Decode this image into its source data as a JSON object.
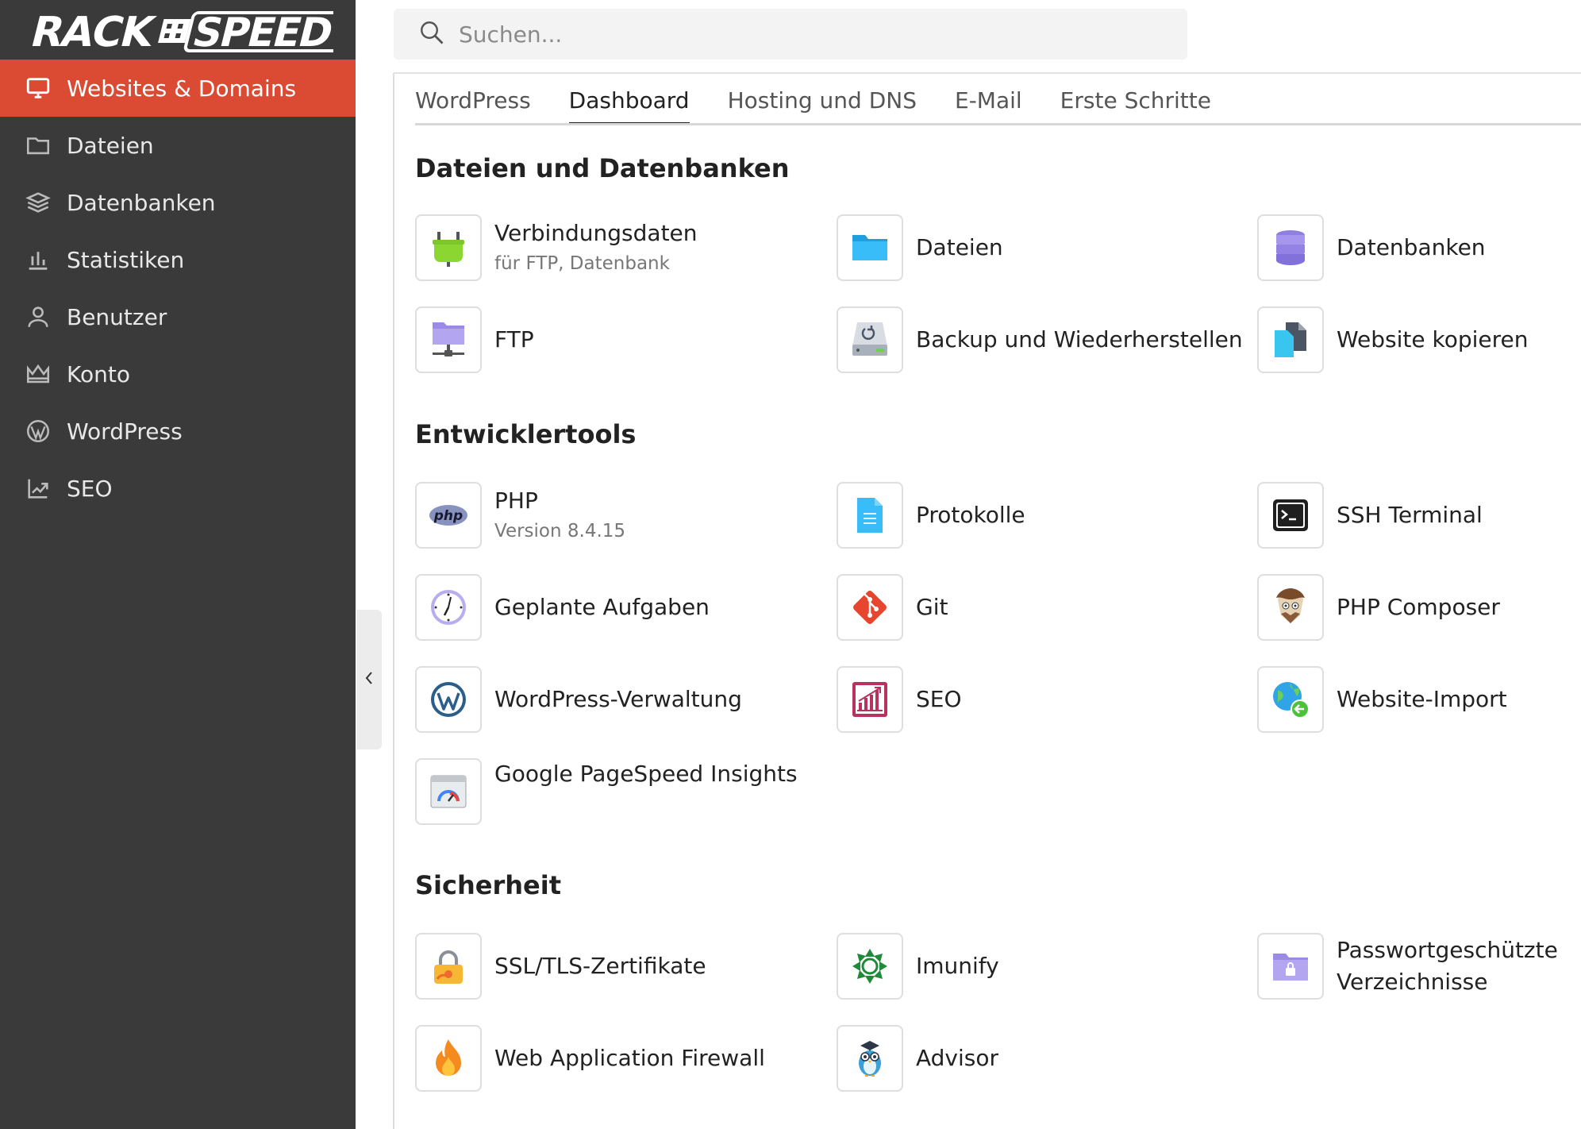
{
  "brand": {
    "logo_text": "RACK#SPEED"
  },
  "search": {
    "placeholder": "Suchen..."
  },
  "sidebar": {
    "items": [
      {
        "label": "Websites & Domains",
        "icon": "monitor-icon",
        "active": true
      },
      {
        "label": "Dateien",
        "icon": "folder-icon"
      },
      {
        "label": "Datenbanken",
        "icon": "layers-icon"
      },
      {
        "label": "Statistiken",
        "icon": "bar-chart-icon"
      },
      {
        "label": "Benutzer",
        "icon": "user-icon"
      },
      {
        "label": "Konto",
        "icon": "crown-icon"
      },
      {
        "label": "WordPress",
        "icon": "wordpress-icon"
      },
      {
        "label": "SEO",
        "icon": "seo-chart-icon"
      }
    ]
  },
  "tabs": [
    {
      "label": "WordPress"
    },
    {
      "label": "Dashboard",
      "active": true
    },
    {
      "label": "Hosting und DNS"
    },
    {
      "label": "E-Mail"
    },
    {
      "label": "Erste Schritte"
    }
  ],
  "sections": [
    {
      "title": "Dateien und Datenbanken",
      "items": [
        {
          "label": "Verbindungsdaten",
          "sub": "für FTP, Datenbank",
          "icon": "plug-icon"
        },
        {
          "label": "Dateien",
          "icon": "folder-icon"
        },
        {
          "label": "Datenbanken",
          "icon": "database-icon"
        },
        {
          "label": "FTP",
          "icon": "ftp-folder-icon"
        },
        {
          "label": "Backup und Wiederherstellen",
          "icon": "backup-drive-icon"
        },
        {
          "label": "Website kopieren",
          "icon": "copy-icon"
        }
      ]
    },
    {
      "title": "Entwicklertools",
      "items": [
        {
          "label": "PHP",
          "sub": "Version 8.4.15",
          "icon": "php-icon"
        },
        {
          "label": "Protokolle",
          "icon": "log-file-icon"
        },
        {
          "label": "SSH Terminal",
          "icon": "terminal-icon"
        },
        {
          "label": "Geplante Aufgaben",
          "icon": "clock-icon"
        },
        {
          "label": "Git",
          "icon": "git-icon"
        },
        {
          "label": "PHP Composer",
          "icon": "composer-icon"
        },
        {
          "label": "WordPress-Verwaltung",
          "icon": "wordpress-icon"
        },
        {
          "label": "SEO",
          "icon": "seo-icon"
        },
        {
          "label": "Website-Import",
          "icon": "globe-import-icon"
        },
        {
          "label": "Google PageSpeed Insights",
          "icon": "pagespeed-icon"
        }
      ]
    },
    {
      "title": "Sicherheit",
      "items": [
        {
          "label": "SSL/TLS-Zertifikate",
          "icon": "lock-icon"
        },
        {
          "label": "Imunify",
          "icon": "imunify-icon"
        },
        {
          "label": "Passwortgeschützte",
          "label2": "Verzeichnisse",
          "icon": "locked-folder-icon"
        },
        {
          "label": "Web Application Firewall",
          "icon": "flame-icon"
        },
        {
          "label": "Advisor",
          "icon": "owl-icon"
        }
      ]
    }
  ],
  "colors": {
    "sidebar_bg": "#3a3a3a",
    "accent": "#db4a33",
    "active_text": "#ffffff"
  }
}
